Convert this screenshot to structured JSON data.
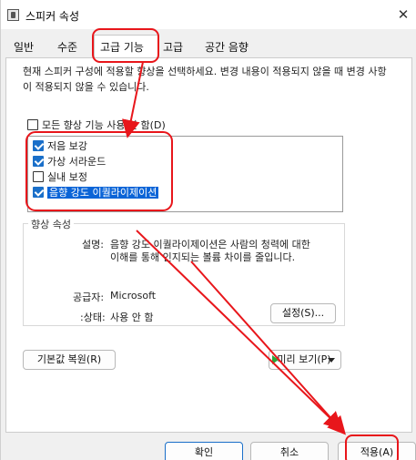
{
  "window": {
    "title": "스피커 속성",
    "close_glyph": "✕"
  },
  "tabs": [
    {
      "label": "일반"
    },
    {
      "label": "수준"
    },
    {
      "label": "고급 기능"
    },
    {
      "label": "고급"
    },
    {
      "label": "공간 음향"
    }
  ],
  "enhancements": {
    "description": "현재 스피커 구성에 적용할 향상을 선택하세요. 변경 내용이 적용되지 않을 때 변경 사항이 적용되지 않을 수 있습니다.",
    "disable_all_label": "모든 향상 기능 사용 안 함(D)",
    "disable_all_checked": false,
    "items": [
      {
        "label": "저음 보강",
        "checked": true
      },
      {
        "label": "가상 서라운드",
        "checked": true
      },
      {
        "label": "실내 보정",
        "checked": false
      },
      {
        "label": "음향 강도 이퀄라이제이션",
        "checked": true,
        "selected": true
      }
    ]
  },
  "properties": {
    "group_title": "향상 속성",
    "description_label": "설명:",
    "description_line1": "음향 강도 이퀄라이제이션은 사람의 청력에 대한",
    "description_line2": "이해를 통해 인지되는 볼륨 차이를 줄입니다.",
    "provider_label": "공급자:",
    "provider_value": "Microsoft",
    "status_label": ":상태:",
    "status_value": "사용 안 함",
    "settings_button": "설정(S)..."
  },
  "actions": {
    "restore_defaults": "기본값 복원(R)",
    "preview": "미리 보기(P)"
  },
  "footer": {
    "ok": "확인",
    "cancel": "취소",
    "apply": "적용(A)"
  },
  "colors": {
    "annotation": "#e8161b",
    "accent": "#1a6fc9",
    "selection": "#0a64d7"
  }
}
